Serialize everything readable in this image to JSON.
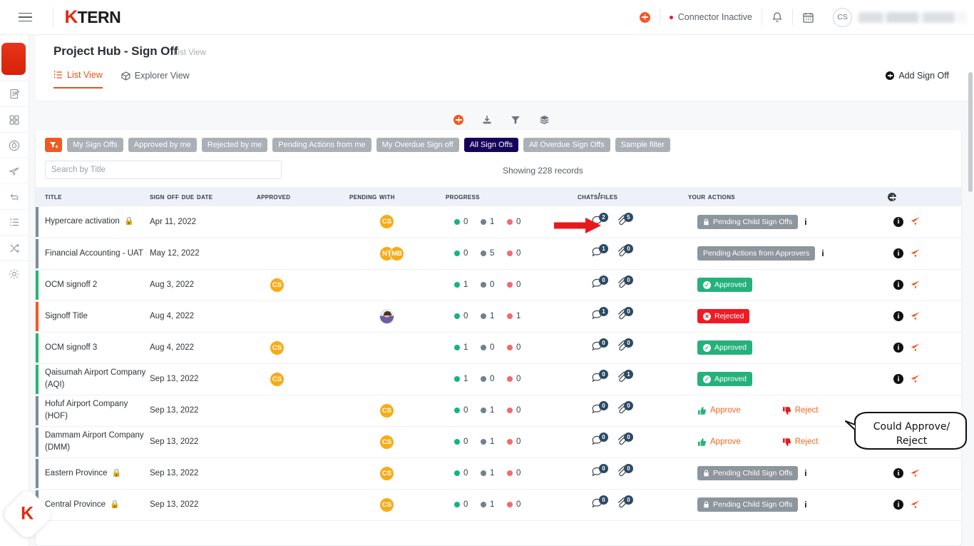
{
  "topbar": {
    "logo_k": "K",
    "logo_rest": "TERN",
    "connector_status": "Connector Inactive",
    "avatar_initials": "CS",
    "icons": [
      "menu-icon",
      "add-circle-icon",
      "bell-icon",
      "calendar-icon"
    ]
  },
  "header": {
    "title": "Project Hub - Sign Off",
    "subtitle": "List View",
    "add_button": "Add Sign Off",
    "tabs": [
      {
        "label": "List View",
        "active": true
      },
      {
        "label": "Explorer View",
        "active": false
      }
    ]
  },
  "toolbar": {
    "icons": [
      "add-circle-icon",
      "download-icon",
      "filter-icon",
      "layers-icon"
    ]
  },
  "filters": {
    "chips": [
      {
        "label": "My Sign Offs",
        "selected": false
      },
      {
        "label": "Approved by me",
        "selected": false
      },
      {
        "label": "Rejected by me",
        "selected": false
      },
      {
        "label": "Pending Actions from me",
        "selected": false
      },
      {
        "label": "My Overdue Sign off",
        "selected": false
      },
      {
        "label": "All Sign Offs",
        "selected": true
      },
      {
        "label": "All Overdue Sign Offs",
        "selected": false
      },
      {
        "label": "Sample filter",
        "selected": false
      }
    ]
  },
  "search": {
    "placeholder": "Search by Title",
    "value": "",
    "records_text": "Showing 228 records"
  },
  "table": {
    "columns": [
      "Title",
      "Sign Off Due Date",
      "Approved",
      "Pending With",
      "Progress",
      "Chats/Files",
      "Your Actions",
      ""
    ],
    "rows": [
      {
        "title": "Hypercare activation",
        "locked": true,
        "bar": "#7d8c99",
        "due": "Apr 11, 2022",
        "approved": [],
        "pending": [
          "CS"
        ],
        "pending_photo": false,
        "progress": {
          "green": 0,
          "slate": 1,
          "red": 0
        },
        "chats": 2,
        "files": 5,
        "action": {
          "type": "pill",
          "style": "gray",
          "label": "Pending Child Sign Offs",
          "lock": true,
          "info": true
        },
        "end_icons": true
      },
      {
        "title": "Financial Accounting - UAT",
        "locked": false,
        "bar": "#7d8c99",
        "due": "May 12, 2022",
        "approved": [],
        "pending": [
          "NT",
          "MB"
        ],
        "pending_photo": false,
        "progress": {
          "green": 0,
          "slate": 5,
          "red": 0
        },
        "chats": 1,
        "files": 0,
        "action": {
          "type": "pill",
          "style": "gray",
          "label": "Pending Actions from Approvers",
          "lock": false,
          "info": true
        },
        "end_icons": true
      },
      {
        "title": "OCM signoff 2",
        "locked": false,
        "bar": "#27b474",
        "due": "Aug 3, 2022",
        "approved": [
          "CS"
        ],
        "pending": [],
        "pending_photo": false,
        "progress": {
          "green": 1,
          "slate": 0,
          "red": 0
        },
        "chats": 0,
        "files": 0,
        "action": {
          "type": "pill",
          "style": "green",
          "label": "Approved",
          "lock": false,
          "info": false
        },
        "end_icons": true
      },
      {
        "title": "Signoff Title",
        "locked": false,
        "bar": "#f05a22",
        "due": "Aug 4, 2022",
        "approved": [],
        "pending": [],
        "pending_photo": true,
        "progress": {
          "green": 0,
          "slate": 1,
          "red": 1
        },
        "chats": 1,
        "files": 0,
        "action": {
          "type": "pill",
          "style": "red",
          "label": "Rejected",
          "lock": false,
          "info": false
        },
        "end_icons": true
      },
      {
        "title": "OCM signoff 3",
        "locked": false,
        "bar": "#27b474",
        "due": "Aug 4, 2022",
        "approved": [
          "CS"
        ],
        "pending": [],
        "pending_photo": false,
        "progress": {
          "green": 1,
          "slate": 0,
          "red": 0
        },
        "chats": 0,
        "files": 0,
        "action": {
          "type": "pill",
          "style": "green",
          "label": "Approved",
          "lock": false,
          "info": false
        },
        "end_icons": true
      },
      {
        "title": "Qaisumah Airport Company (AQI)",
        "locked": false,
        "bar": "#27b474",
        "due": "Sep 13, 2022",
        "approved": [
          "CS"
        ],
        "pending": [],
        "pending_photo": false,
        "progress": {
          "green": 1,
          "slate": 0,
          "red": 0
        },
        "chats": 0,
        "files": 1,
        "action": {
          "type": "pill",
          "style": "green",
          "label": "Approved",
          "lock": false,
          "info": false
        },
        "end_icons": true
      },
      {
        "title": "Hofuf Airport Company (HOF)",
        "locked": false,
        "bar": "#7d8c99",
        "due": "Sep 13, 2022",
        "approved": [],
        "pending": [
          "CS"
        ],
        "pending_photo": false,
        "progress": {
          "green": 0,
          "slate": 1,
          "red": 0
        },
        "chats": 0,
        "files": 0,
        "action": {
          "type": "approve_reject",
          "approve": "Approve",
          "reject": "Reject"
        },
        "end_icons": false
      },
      {
        "title": "Dammam Airport Company (DMM)",
        "locked": false,
        "bar": "#7d8c99",
        "due": "Sep 13, 2022",
        "approved": [],
        "pending": [
          "CS"
        ],
        "pending_photo": false,
        "progress": {
          "green": 0,
          "slate": 1,
          "red": 0
        },
        "chats": 0,
        "files": 0,
        "action": {
          "type": "approve_reject",
          "approve": "Approve",
          "reject": "Reject"
        },
        "end_icons": true
      },
      {
        "title": "Eastern Province",
        "locked": true,
        "bar": "#7d8c99",
        "due": "Sep 13, 2022",
        "approved": [],
        "pending": [
          "CS"
        ],
        "pending_photo": false,
        "progress": {
          "green": 0,
          "slate": 1,
          "red": 0
        },
        "chats": 0,
        "files": 0,
        "action": {
          "type": "pill",
          "style": "gray",
          "label": "Pending Child Sign Offs",
          "lock": true,
          "info": true
        },
        "end_icons": true
      },
      {
        "title": "Central Province",
        "locked": true,
        "bar": "#7d8c99",
        "due": "Sep 13, 2022",
        "approved": [],
        "pending": [
          "CS"
        ],
        "pending_photo": false,
        "progress": {
          "green": 0,
          "slate": 1,
          "red": 0
        },
        "chats": 0,
        "files": 0,
        "action": {
          "type": "pill",
          "style": "gray",
          "label": "Pending Child Sign Offs",
          "lock": true,
          "info": true
        },
        "end_icons": true
      }
    ]
  },
  "annotations": {
    "callout_text": "Could Approve/ Reject",
    "arrow": "red-arrow-pointing-to-chat-icon"
  },
  "colors": {
    "accent": "#ef5a22",
    "selected_chip": "#15025a",
    "approved": "#25b17c",
    "rejected": "#f01a24",
    "pending": "#8d959d",
    "avatar": "#f8ab17"
  },
  "sidebar": {
    "icons": [
      "app-tile-icon",
      "edit-note-icon",
      "grid-icon",
      "gauge-icon",
      "send-icon",
      "refresh-icon",
      "list-icon",
      "shuffle-icon",
      "gear-icon"
    ]
  }
}
